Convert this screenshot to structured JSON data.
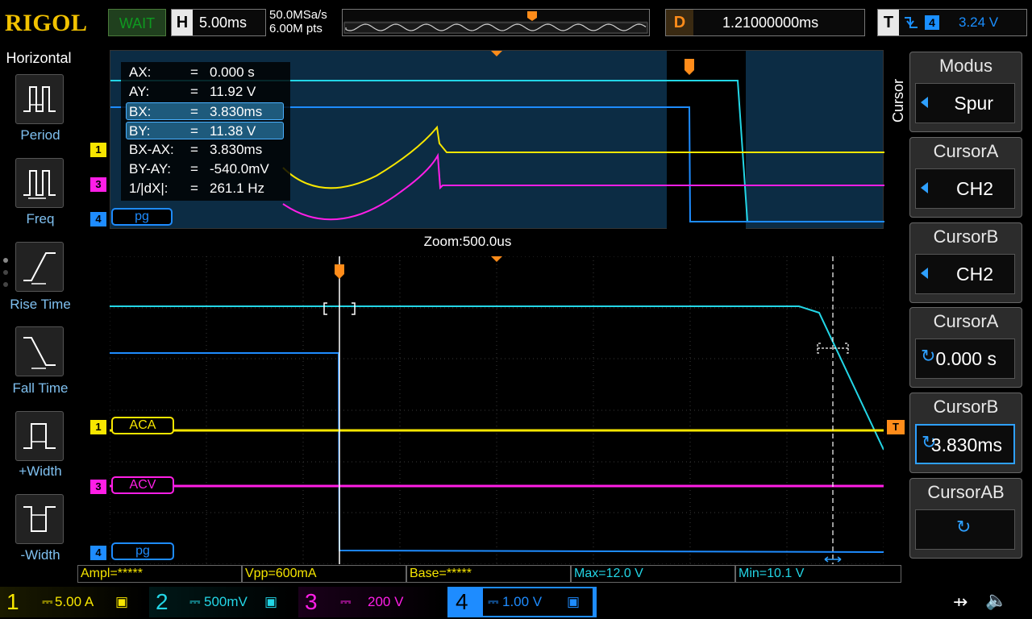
{
  "brand": "RIGOL",
  "status": "WAIT",
  "horizontal": {
    "key": "H",
    "timebase": "5.00ms"
  },
  "acquisition": {
    "sample_rate": "50.0MSa/s",
    "memory_depth": "6.00M pts"
  },
  "delay": {
    "key": "D",
    "value": "1.21000000ms"
  },
  "trigger": {
    "key": "T",
    "source": "4",
    "level": "3.24 V",
    "marker": "T"
  },
  "left_menu": {
    "title": "Horizontal",
    "items": [
      {
        "label": "Period"
      },
      {
        "label": "Freq"
      },
      {
        "label": "Rise Time"
      },
      {
        "label": "Fall Time"
      },
      {
        "label": "+Width"
      },
      {
        "label": "-Width"
      }
    ]
  },
  "right_menu": {
    "side_label": "Cursor",
    "items": [
      {
        "title": "Modus",
        "value": "Spur"
      },
      {
        "title": "CursorA",
        "value": "CH2"
      },
      {
        "title": "CursorB",
        "value": "CH2"
      },
      {
        "title": "CursorA",
        "value": "0.000 s"
      },
      {
        "title": "CursorB",
        "value": "3.830ms"
      },
      {
        "title": "CursorAB",
        "value": ""
      }
    ]
  },
  "cursor_readout": [
    {
      "name": "AX:",
      "value": "0.000 s"
    },
    {
      "name": "AY:",
      "value": "11.92 V"
    },
    {
      "name": "BX:",
      "value": "3.830ms"
    },
    {
      "name": "BY:",
      "value": "11.38 V"
    },
    {
      "name": "BX-AX:",
      "value": "3.830ms"
    },
    {
      "name": "BY-AY:",
      "value": "-540.0mV"
    },
    {
      "name": "1/|dX|:",
      "value": "261.1 Hz"
    }
  ],
  "cursor_eq": "=",
  "zoom_label": "Zoom:500.0us",
  "overview_tags": {
    "ch4": "pg"
  },
  "main_tags": {
    "ch1": "ACA",
    "ch3": "ACV",
    "ch4": "pg"
  },
  "channel_numbers": {
    "ch1": "1",
    "ch2": "2",
    "ch3": "3",
    "ch4": "4"
  },
  "measurements": [
    "Ampl=*****",
    "Vpp=600mA",
    "Base=*****",
    "Max=12.0 V",
    "Min=10.1 V"
  ],
  "channels": [
    {
      "num": "1",
      "scale": "5.00 A",
      "color": "#f7e600"
    },
    {
      "num": "2",
      "scale": "500mV",
      "color": "#23d6e6"
    },
    {
      "num": "3",
      "scale": "200 V",
      "color": "#ff1ee6"
    },
    {
      "num": "4",
      "scale": "1.00 V",
      "color": "#1e8cff"
    }
  ],
  "colors": {
    "ch1": "#f7e600",
    "ch2": "#23d6e6",
    "ch3": "#ff1ee6",
    "ch4": "#1e8cff",
    "trigger": "#ff8c1a",
    "accent": "#2ea0ff"
  }
}
